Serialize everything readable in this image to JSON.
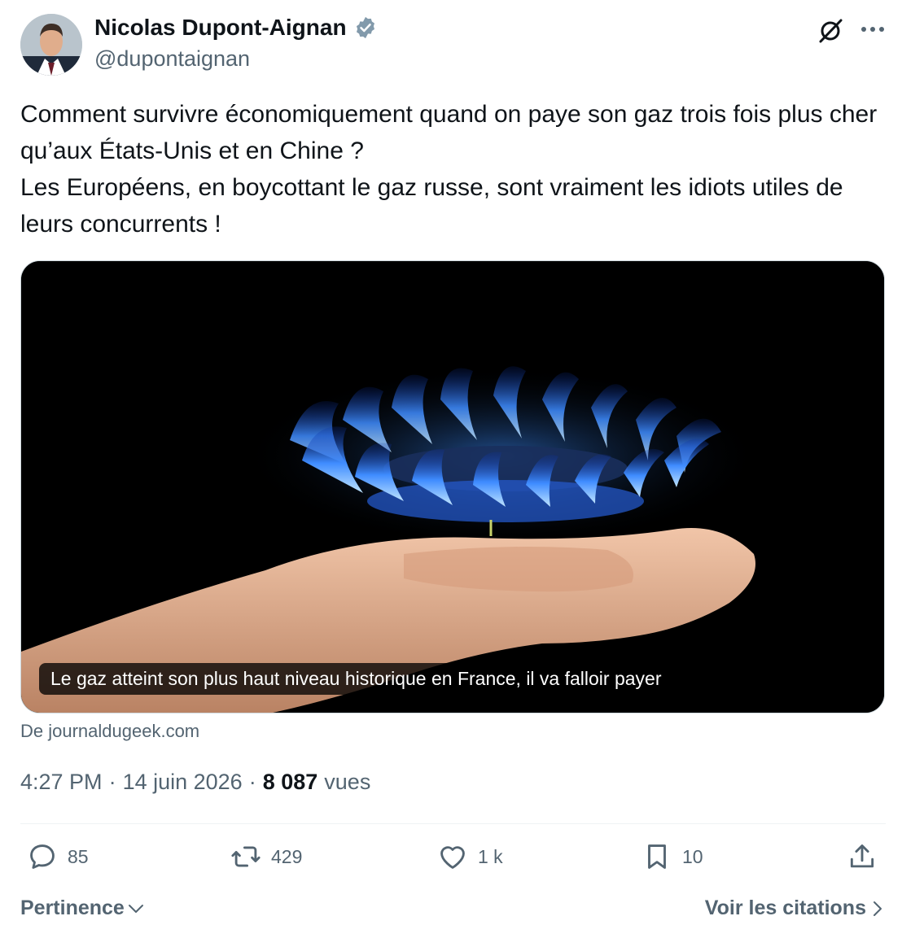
{
  "author": {
    "display_name": "Nicolas Dupont-Aignan",
    "handle": "@dupontaignan",
    "verified": true,
    "avatar_icon": "profile-photo"
  },
  "header_icons": {
    "grok": "grok-icon",
    "more": "more-icon"
  },
  "tweet": {
    "lines": [
      "Comment survivre économiquement quand on paye son gaz trois fois plus cher qu’aux États-Unis et en Chine ?",
      "Les Européens, en boycottant le gaz russe, sont vraiment les idiots utiles de leurs concurrents !"
    ]
  },
  "media": {
    "caption": "Le gaz atteint son plus haut niveau historique en France, il va falloir payer",
    "source": "De journaldugeek.com"
  },
  "meta": {
    "time": "4:27 PM",
    "separator": "·",
    "date": "14 juin 2026",
    "views_count": "8 087",
    "views_label": "vues"
  },
  "actions": {
    "replies": "85",
    "retweets": "429",
    "likes": "1 k",
    "bookmarks": "10"
  },
  "footer": {
    "sort_label": "Pertinence",
    "quotes_label": "Voir les citations"
  },
  "colors": {
    "text_primary": "#0f1419",
    "text_secondary": "#536471",
    "verified_badge": "#829aab",
    "flame_blue": "#2f7bff"
  }
}
